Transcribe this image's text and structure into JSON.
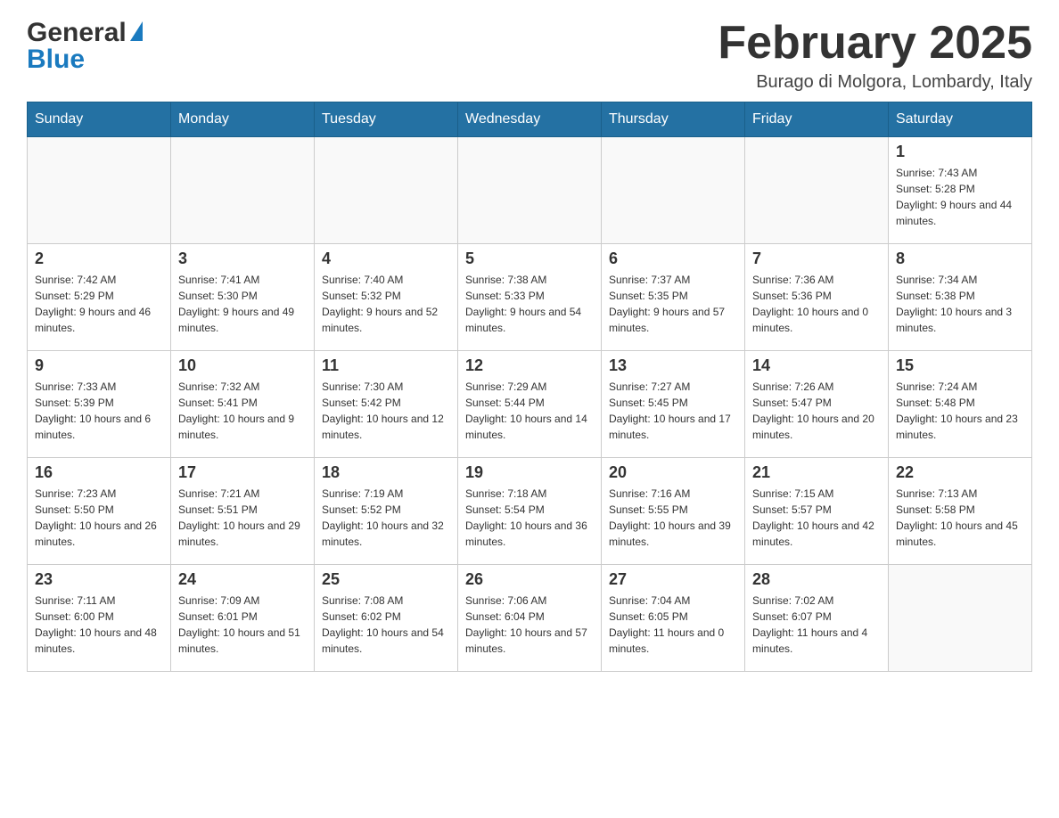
{
  "header": {
    "logo": {
      "general": "General",
      "blue": "Blue",
      "alt": "GeneralBlue logo"
    },
    "title": "February 2025",
    "location": "Burago di Molgora, Lombardy, Italy"
  },
  "weekdays": [
    "Sunday",
    "Monday",
    "Tuesday",
    "Wednesday",
    "Thursday",
    "Friday",
    "Saturday"
  ],
  "weeks": [
    [
      {
        "day": "",
        "info": ""
      },
      {
        "day": "",
        "info": ""
      },
      {
        "day": "",
        "info": ""
      },
      {
        "day": "",
        "info": ""
      },
      {
        "day": "",
        "info": ""
      },
      {
        "day": "",
        "info": ""
      },
      {
        "day": "1",
        "info": "Sunrise: 7:43 AM\nSunset: 5:28 PM\nDaylight: 9 hours and 44 minutes."
      }
    ],
    [
      {
        "day": "2",
        "info": "Sunrise: 7:42 AM\nSunset: 5:29 PM\nDaylight: 9 hours and 46 minutes."
      },
      {
        "day": "3",
        "info": "Sunrise: 7:41 AM\nSunset: 5:30 PM\nDaylight: 9 hours and 49 minutes."
      },
      {
        "day": "4",
        "info": "Sunrise: 7:40 AM\nSunset: 5:32 PM\nDaylight: 9 hours and 52 minutes."
      },
      {
        "day": "5",
        "info": "Sunrise: 7:38 AM\nSunset: 5:33 PM\nDaylight: 9 hours and 54 minutes."
      },
      {
        "day": "6",
        "info": "Sunrise: 7:37 AM\nSunset: 5:35 PM\nDaylight: 9 hours and 57 minutes."
      },
      {
        "day": "7",
        "info": "Sunrise: 7:36 AM\nSunset: 5:36 PM\nDaylight: 10 hours and 0 minutes."
      },
      {
        "day": "8",
        "info": "Sunrise: 7:34 AM\nSunset: 5:38 PM\nDaylight: 10 hours and 3 minutes."
      }
    ],
    [
      {
        "day": "9",
        "info": "Sunrise: 7:33 AM\nSunset: 5:39 PM\nDaylight: 10 hours and 6 minutes."
      },
      {
        "day": "10",
        "info": "Sunrise: 7:32 AM\nSunset: 5:41 PM\nDaylight: 10 hours and 9 minutes."
      },
      {
        "day": "11",
        "info": "Sunrise: 7:30 AM\nSunset: 5:42 PM\nDaylight: 10 hours and 12 minutes."
      },
      {
        "day": "12",
        "info": "Sunrise: 7:29 AM\nSunset: 5:44 PM\nDaylight: 10 hours and 14 minutes."
      },
      {
        "day": "13",
        "info": "Sunrise: 7:27 AM\nSunset: 5:45 PM\nDaylight: 10 hours and 17 minutes."
      },
      {
        "day": "14",
        "info": "Sunrise: 7:26 AM\nSunset: 5:47 PM\nDaylight: 10 hours and 20 minutes."
      },
      {
        "day": "15",
        "info": "Sunrise: 7:24 AM\nSunset: 5:48 PM\nDaylight: 10 hours and 23 minutes."
      }
    ],
    [
      {
        "day": "16",
        "info": "Sunrise: 7:23 AM\nSunset: 5:50 PM\nDaylight: 10 hours and 26 minutes."
      },
      {
        "day": "17",
        "info": "Sunrise: 7:21 AM\nSunset: 5:51 PM\nDaylight: 10 hours and 29 minutes."
      },
      {
        "day": "18",
        "info": "Sunrise: 7:19 AM\nSunset: 5:52 PM\nDaylight: 10 hours and 32 minutes."
      },
      {
        "day": "19",
        "info": "Sunrise: 7:18 AM\nSunset: 5:54 PM\nDaylight: 10 hours and 36 minutes."
      },
      {
        "day": "20",
        "info": "Sunrise: 7:16 AM\nSunset: 5:55 PM\nDaylight: 10 hours and 39 minutes."
      },
      {
        "day": "21",
        "info": "Sunrise: 7:15 AM\nSunset: 5:57 PM\nDaylight: 10 hours and 42 minutes."
      },
      {
        "day": "22",
        "info": "Sunrise: 7:13 AM\nSunset: 5:58 PM\nDaylight: 10 hours and 45 minutes."
      }
    ],
    [
      {
        "day": "23",
        "info": "Sunrise: 7:11 AM\nSunset: 6:00 PM\nDaylight: 10 hours and 48 minutes."
      },
      {
        "day": "24",
        "info": "Sunrise: 7:09 AM\nSunset: 6:01 PM\nDaylight: 10 hours and 51 minutes."
      },
      {
        "day": "25",
        "info": "Sunrise: 7:08 AM\nSunset: 6:02 PM\nDaylight: 10 hours and 54 minutes."
      },
      {
        "day": "26",
        "info": "Sunrise: 7:06 AM\nSunset: 6:04 PM\nDaylight: 10 hours and 57 minutes."
      },
      {
        "day": "27",
        "info": "Sunrise: 7:04 AM\nSunset: 6:05 PM\nDaylight: 11 hours and 0 minutes."
      },
      {
        "day": "28",
        "info": "Sunrise: 7:02 AM\nSunset: 6:07 PM\nDaylight: 11 hours and 4 minutes."
      },
      {
        "day": "",
        "info": ""
      }
    ]
  ]
}
